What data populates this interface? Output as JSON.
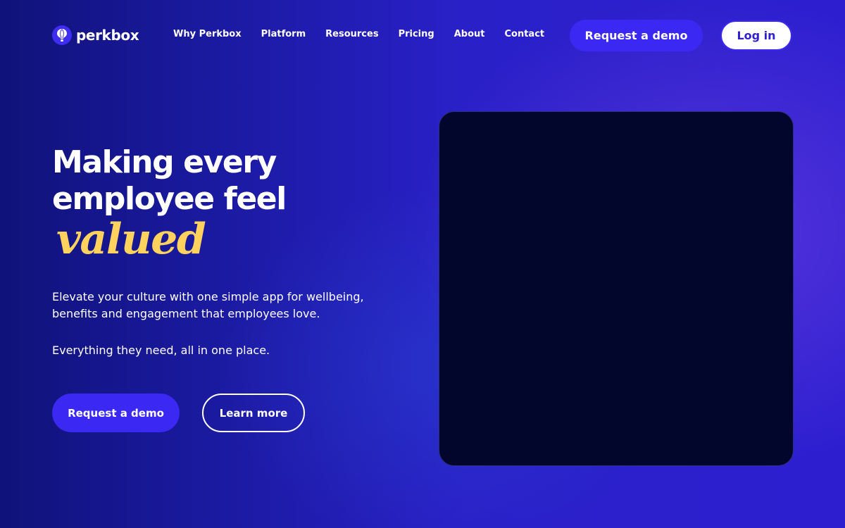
{
  "header": {
    "logo_text": "perkbox",
    "logo_icon": "hot-air-balloon-icon",
    "nav": [
      {
        "label": "Why Perkbox"
      },
      {
        "label": "Platform"
      },
      {
        "label": "Resources"
      },
      {
        "label": "Pricing"
      },
      {
        "label": "About"
      },
      {
        "label": "Contact"
      }
    ],
    "request_demo_label": "Request a demo",
    "login_label": "Log in"
  },
  "hero": {
    "title_line1": "Making every",
    "title_line2": "employee feel",
    "title_accent": "valued",
    "description": "Elevate your culture with one simple app for wellbeing, benefits and engagement that employees love.",
    "subtext": "Everything they need, all in one place.",
    "primary_cta": "Request a demo",
    "secondary_cta": "Learn more"
  },
  "colors": {
    "brand_blue": "#3b28f2",
    "accent_yellow": "#ffd25e",
    "background_dark": "#10127a",
    "media_panel": "#03062c"
  }
}
